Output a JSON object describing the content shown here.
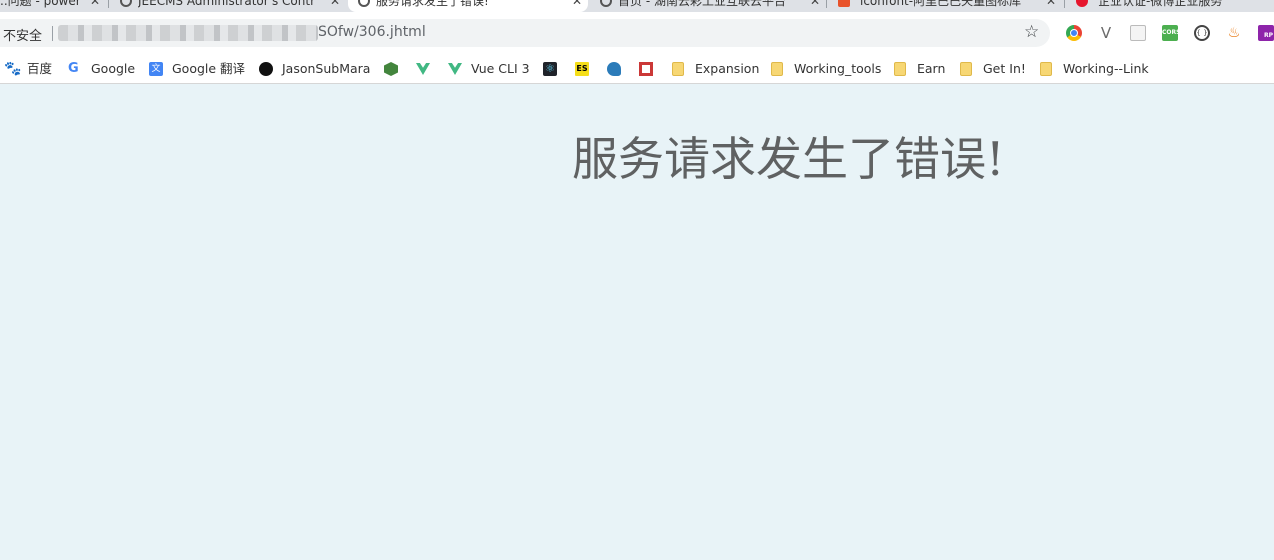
{
  "tabs": [
    {
      "title": "..问题 - power",
      "close": "✕"
    },
    {
      "title": "JEECMS Administrator's Contr",
      "close": "✕"
    },
    {
      "title": "服务请求发生了错误!",
      "close": "✕"
    },
    {
      "title": "首页 - 湖南云彩工业互联云平台",
      "close": "✕"
    },
    {
      "title": "iconfont-阿里巴巴矢量图标库",
      "close": "✕"
    },
    {
      "title": "企业认证-微博企业服务",
      "close": ""
    }
  ],
  "toolbar": {
    "security_label": "不安全",
    "url_visible": "SOfw/306.jhtml",
    "star_glyph": "☆",
    "ext_vee_glyph": "V",
    "ext_cors_label": "CORS",
    "ext_code_label": "{ }",
    "ext_java_glyph": "♨",
    "ext_rp_label": "RP"
  },
  "bookmarks": [
    {
      "label": "百度",
      "icon": "baidu-icon"
    },
    {
      "label": "Google",
      "icon": "google-icon"
    },
    {
      "label": "Google 翻译",
      "icon": "google-translate-icon"
    },
    {
      "label": "JasonSubMara",
      "icon": "github-icon"
    },
    {
      "label": "",
      "icon": "nodejs-icon"
    },
    {
      "label": "",
      "icon": "vue-icon"
    },
    {
      "label": "Vue CLI 3",
      "icon": "vue-icon"
    },
    {
      "label": "",
      "icon": "react-icon"
    },
    {
      "label": "",
      "icon": "es-icon"
    },
    {
      "label": "",
      "icon": "bird-icon"
    },
    {
      "label": "",
      "icon": "npm-icon"
    },
    {
      "label": "Expansion",
      "icon": "folder-icon"
    },
    {
      "label": "Working_tools",
      "icon": "folder-icon"
    },
    {
      "label": "Earn",
      "icon": "folder-icon"
    },
    {
      "label": "Get In!",
      "icon": "folder-icon"
    },
    {
      "label": "Working--Link",
      "icon": "folder-icon"
    }
  ],
  "icon_glyphs": {
    "baidu": "🐾",
    "google": "G",
    "google_translate": "文",
    "react": "⚛",
    "es": "ES"
  },
  "page": {
    "error_message": "服务请求发生了错误!"
  },
  "colors": {
    "page_background": "#e8f3f7",
    "error_text": "#5f6162",
    "tabstrip": "#dee1e6",
    "omnibox": "#f1f3f4"
  }
}
